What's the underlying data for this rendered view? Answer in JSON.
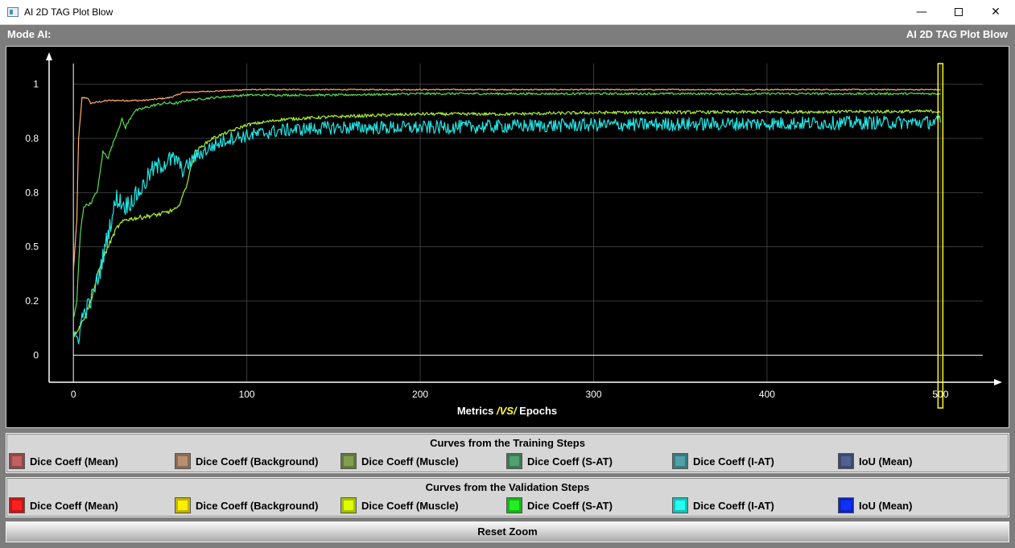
{
  "window": {
    "title": "AI 2D TAG Plot Blow"
  },
  "header": {
    "mode_label": "Mode AI:",
    "plot_title": "AI 2D TAG Plot Blow"
  },
  "chart_data": {
    "type": "line",
    "title": "",
    "xlabel_parts": [
      "Metrics ",
      "/VS/",
      " Epochs"
    ],
    "xlim": [
      -14,
      530
    ],
    "ylim": [
      -0.1,
      1.1
    ],
    "x_ticks": [
      0,
      100,
      200,
      300,
      400,
      500
    ],
    "y_ticks": [
      0,
      0.2,
      0.4,
      0.6,
      0.8,
      1
    ],
    "y_tick_labels": [
      "0",
      "0.2",
      "0.5",
      "0.8",
      "0.8",
      "1"
    ],
    "grid": true,
    "marker_epoch": 500,
    "series": [
      {
        "name": "Dice Coeff (Background)",
        "color": "#ffb066",
        "noise": 0.002,
        "points": [
          [
            0,
            0.31
          ],
          [
            2,
            0.5
          ],
          [
            3,
            0.8
          ],
          [
            5,
            0.95
          ],
          [
            8,
            0.95
          ],
          [
            10,
            0.93
          ],
          [
            20,
            0.94
          ],
          [
            40,
            0.94
          ],
          [
            55,
            0.95
          ],
          [
            60,
            0.96
          ],
          [
            63,
            0.97
          ],
          [
            65,
            0.97
          ],
          [
            100,
            0.98
          ],
          [
            200,
            0.98
          ],
          [
            500,
            0.98
          ]
        ]
      },
      {
        "name": "Dice Coeff (S-AT)",
        "color": "#55dd55",
        "noise": 0.004,
        "points": [
          [
            0,
            0.13
          ],
          [
            2,
            0.2
          ],
          [
            4,
            0.45
          ],
          [
            6,
            0.55
          ],
          [
            10,
            0.56
          ],
          [
            14,
            0.61
          ],
          [
            17,
            0.75
          ],
          [
            20,
            0.73
          ],
          [
            25,
            0.82
          ],
          [
            28,
            0.87
          ],
          [
            30,
            0.84
          ],
          [
            35,
            0.9
          ],
          [
            45,
            0.92
          ],
          [
            52,
            0.93
          ],
          [
            60,
            0.93
          ],
          [
            65,
            0.94
          ],
          [
            80,
            0.95
          ],
          [
            100,
            0.96
          ],
          [
            150,
            0.96
          ],
          [
            200,
            0.965
          ],
          [
            500,
            0.965
          ]
        ]
      },
      {
        "name": "Dice Coeff (Muscle)",
        "color": "#aaee33",
        "noise": 0.006,
        "points": [
          [
            0,
            0.07
          ],
          [
            5,
            0.12
          ],
          [
            10,
            0.2
          ],
          [
            15,
            0.32
          ],
          [
            20,
            0.4
          ],
          [
            25,
            0.47
          ],
          [
            30,
            0.5
          ],
          [
            40,
            0.51
          ],
          [
            50,
            0.52
          ],
          [
            60,
            0.54
          ],
          [
            65,
            0.62
          ],
          [
            70,
            0.75
          ],
          [
            80,
            0.8
          ],
          [
            100,
            0.85
          ],
          [
            120,
            0.87
          ],
          [
            150,
            0.88
          ],
          [
            200,
            0.89
          ],
          [
            250,
            0.89
          ],
          [
            300,
            0.895
          ],
          [
            500,
            0.9
          ]
        ]
      },
      {
        "name": "Dice Coeff (I-AT)",
        "color": "#22e5e5",
        "noise": 0.025,
        "points": [
          [
            0,
            0.05
          ],
          [
            3,
            0.07
          ],
          [
            5,
            0.14
          ],
          [
            10,
            0.2
          ],
          [
            15,
            0.3
          ],
          [
            20,
            0.45
          ],
          [
            25,
            0.58
          ],
          [
            30,
            0.55
          ],
          [
            35,
            0.58
          ],
          [
            40,
            0.62
          ],
          [
            45,
            0.68
          ],
          [
            50,
            0.7
          ],
          [
            55,
            0.72
          ],
          [
            60,
            0.72
          ],
          [
            63,
            0.68
          ],
          [
            70,
            0.73
          ],
          [
            80,
            0.77
          ],
          [
            90,
            0.8
          ],
          [
            100,
            0.81
          ],
          [
            120,
            0.83
          ],
          [
            150,
            0.84
          ],
          [
            200,
            0.84
          ],
          [
            300,
            0.85
          ],
          [
            400,
            0.855
          ],
          [
            500,
            0.86
          ]
        ]
      }
    ]
  },
  "legend": {
    "training": {
      "title": "Curves from the Training Steps",
      "items": [
        {
          "label": "Dice Coeff (Mean)",
          "color": "#c06060"
        },
        {
          "label": "Dice Coeff (Background)",
          "color": "#b89070"
        },
        {
          "label": "Dice Coeff (Muscle)",
          "color": "#80a050"
        },
        {
          "label": "Dice Coeff (S-AT)",
          "color": "#50a070"
        },
        {
          "label": "Dice Coeff (I-AT)",
          "color": "#50a0a8"
        },
        {
          "label": "IoU (Mean)",
          "color": "#506090"
        }
      ]
    },
    "validation": {
      "title": "Curves from the Validation Steps",
      "items": [
        {
          "label": "Dice Coeff (Mean)",
          "color": "#ff2020"
        },
        {
          "label": "Dice Coeff (Background)",
          "color": "#ffee00"
        },
        {
          "label": "Dice Coeff (Muscle)",
          "color": "#ddff00"
        },
        {
          "label": "Dice Coeff (S-AT)",
          "color": "#22ee22"
        },
        {
          "label": "Dice Coeff (I-AT)",
          "color": "#22ffee"
        },
        {
          "label": "IoU (Mean)",
          "color": "#1030ff"
        }
      ]
    }
  },
  "reset_button": {
    "label": "Reset Zoom"
  }
}
